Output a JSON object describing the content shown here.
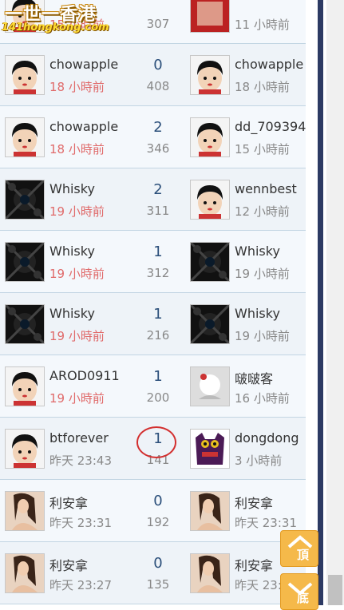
{
  "header": {
    "logo_title": "一世一香港",
    "logo_url": "141hongkong.com"
  },
  "rows": [
    {
      "left": {
        "name": "",
        "time": "15 小時前",
        "recent": true,
        "avatar": "default-avatar"
      },
      "replies": "",
      "views": "307",
      "right": {
        "name": "",
        "time": "11 小時前",
        "avatar": "red-photo-avatar"
      }
    },
    {
      "left": {
        "name": "chowapple",
        "time": "18 小時前",
        "recent": true,
        "avatar": "default-avatar"
      },
      "replies": "0",
      "views": "408",
      "right": {
        "name": "chowapple",
        "time": "18 小時前",
        "avatar": "default-avatar"
      }
    },
    {
      "left": {
        "name": "chowapple",
        "time": "18 小時前",
        "recent": true,
        "avatar": "default-avatar"
      },
      "replies": "2",
      "views": "346",
      "right": {
        "name": "dd_709394",
        "time": "15 小時前",
        "avatar": "default-avatar"
      }
    },
    {
      "left": {
        "name": "Whisky",
        "time": "19 小時前",
        "recent": true,
        "avatar": "dark-pattern-avatar"
      },
      "replies": "2",
      "views": "311",
      "right": {
        "name": "wennbest",
        "time": "12 小時前",
        "avatar": "default-avatar"
      }
    },
    {
      "left": {
        "name": "Whisky",
        "time": "19 小時前",
        "recent": true,
        "avatar": "dark-pattern-avatar"
      },
      "replies": "1",
      "views": "312",
      "right": {
        "name": "Whisky",
        "time": "19 小時前",
        "avatar": "dark-pattern-avatar"
      }
    },
    {
      "left": {
        "name": "Whisky",
        "time": "19 小時前",
        "recent": true,
        "avatar": "dark-pattern-avatar"
      },
      "replies": "1",
      "views": "216",
      "right": {
        "name": "Whisky",
        "time": "19 小時前",
        "avatar": "dark-pattern-avatar"
      }
    },
    {
      "left": {
        "name": "AROD0911",
        "time": "19 小時前",
        "recent": true,
        "avatar": "default-avatar"
      },
      "replies": "1",
      "views": "200",
      "right": {
        "name": "啵啵客",
        "time": "16 小時前",
        "avatar": "white-flower-avatar"
      }
    },
    {
      "left": {
        "name": "btforever",
        "time": "昨天 23:43",
        "recent": false,
        "avatar": "default-avatar"
      },
      "replies": "1",
      "views": "141",
      "right": {
        "name": "dongdong",
        "time": "3 小時前",
        "avatar": "purple-monster-avatar"
      }
    },
    {
      "left": {
        "name": "利安拿",
        "time": "昨天 23:31",
        "recent": false,
        "avatar": "woman-photo-avatar"
      },
      "replies": "0",
      "views": "192",
      "right": {
        "name": "利安拿",
        "time": "昨天 23:31",
        "avatar": "woman-photo-avatar"
      }
    },
    {
      "left": {
        "name": "利安拿",
        "time": "昨天 23:27",
        "recent": false,
        "avatar": "woman-photo-avatar"
      },
      "replies": "0",
      "views": "135",
      "right": {
        "name": "利安拿",
        "time": "昨天 23:27",
        "avatar": "woman-photo-avatar"
      }
    }
  ],
  "floating": {
    "top_label": "頂",
    "bottom_label": "底"
  },
  "colors": {
    "accent": "#f5b94a",
    "recent_time": "#e06a6a",
    "reply_count": "#2b4f7a",
    "annotation": "#d32f2f"
  }
}
